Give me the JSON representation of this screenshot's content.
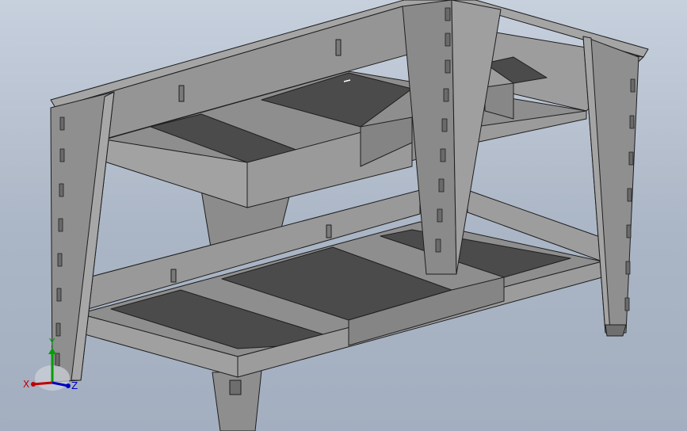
{
  "viewport": {
    "background_top": "#c7d0dd",
    "background_bottom": "#a3afc0",
    "part_color_light": "#9a9a9a",
    "part_color_mid": "#7d7d7d",
    "part_color_dark": "#4e4e4e",
    "edge_color": "#1e1e1e"
  },
  "triad": {
    "x_label": "X",
    "y_label": "Y",
    "z_label": "Z",
    "x_color": "#c00000",
    "y_color": "#00a000",
    "z_color": "#0000c0"
  }
}
